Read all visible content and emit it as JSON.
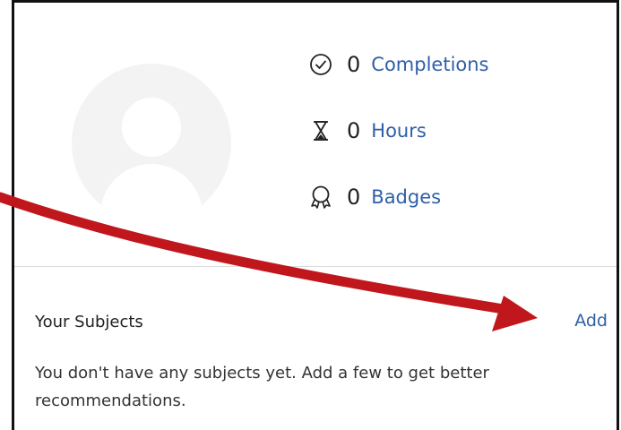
{
  "stats": [
    {
      "value": "0",
      "label": "Completions",
      "icon": "check-circle-icon"
    },
    {
      "value": "0",
      "label": "Hours",
      "icon": "hourglass-icon"
    },
    {
      "value": "0",
      "label": "Badges",
      "icon": "badge-ribbon-icon"
    }
  ],
  "subjects": {
    "title": "Your Subjects",
    "add_label": "Add",
    "empty_message": "You don't have any subjects yet. Add a few to get better recommendations."
  },
  "colors": {
    "link": "#2e5fa8",
    "annotation_arrow": "#c0171d",
    "border": "#111111"
  }
}
